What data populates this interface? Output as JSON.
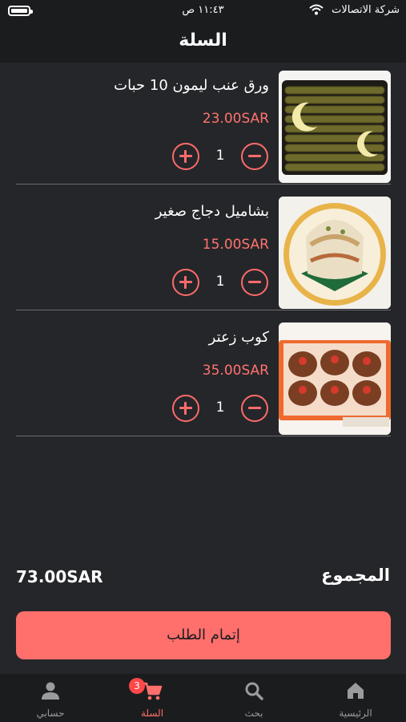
{
  "status_bar": {
    "carrier": "شركة الاتصالات",
    "time": "١١:٤٣ ص"
  },
  "header": {
    "title": "السلة"
  },
  "cart": {
    "items": [
      {
        "name": "ورق عنب ليمون 10 حبات",
        "price": "23.00SAR",
        "quantity": "1"
      },
      {
        "name": "بشاميل دجاج صغير",
        "price": "15.00SAR",
        "quantity": "1"
      },
      {
        "name": "كوب زعتر",
        "price": "35.00SAR",
        "quantity": "1"
      }
    ]
  },
  "summary": {
    "total_label": "المجموع",
    "total_value": "73.00SAR"
  },
  "checkout": {
    "label": "إتمام الطلب"
  },
  "tabbar": {
    "tabs": [
      {
        "label": "الرئيسية",
        "icon": "home-icon"
      },
      {
        "label": "بحث",
        "icon": "search-icon"
      },
      {
        "label": "السلة",
        "icon": "cart-icon",
        "badge": "3",
        "active": true
      },
      {
        "label": "حسابي",
        "icon": "person-icon"
      }
    ]
  },
  "colors": {
    "accent": "#ff6f6c",
    "background": "#252629",
    "bar": "#1b1c1e"
  }
}
